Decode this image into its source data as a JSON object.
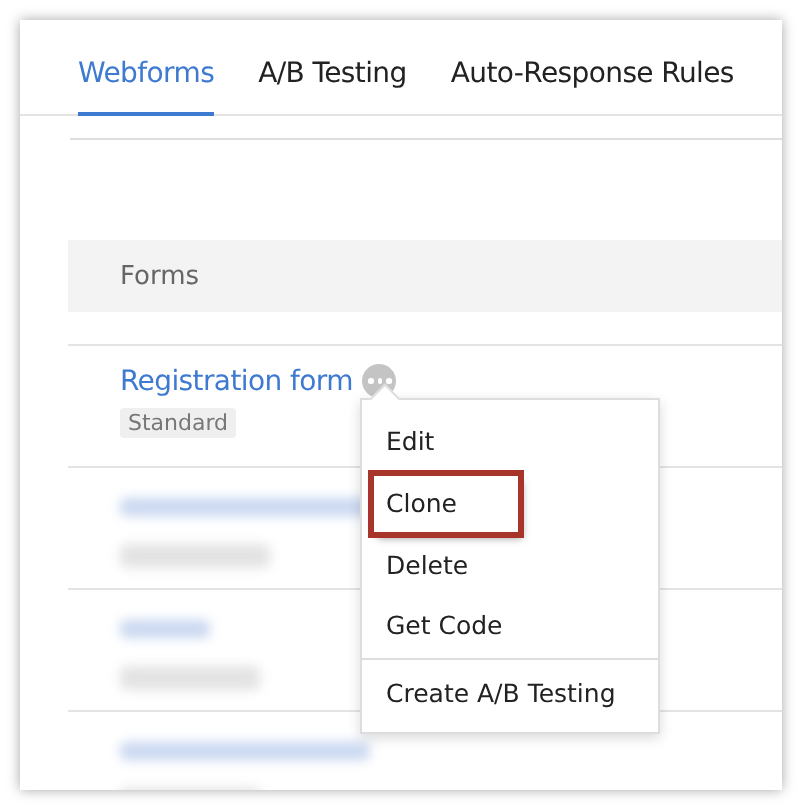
{
  "tabs": [
    {
      "label": "Webforms",
      "selected": true
    },
    {
      "label": "A/B Testing",
      "selected": false
    },
    {
      "label": "Auto-Response Rules",
      "selected": false
    }
  ],
  "table": {
    "header": "Forms",
    "rows": [
      {
        "kind": "form",
        "name": "Registration form",
        "tag": "Standard"
      },
      {
        "kind": "blurred"
      },
      {
        "kind": "blurred"
      },
      {
        "kind": "blurred"
      }
    ]
  },
  "menu": {
    "items": [
      {
        "label": "Edit",
        "selected": false
      },
      {
        "label": "Clone",
        "selected": true
      },
      {
        "label": "Delete",
        "selected": false
      },
      {
        "label": "Get Code",
        "selected": false
      },
      {
        "label": "Create A/B Testing",
        "selected": false,
        "divider_before": true
      }
    ]
  }
}
